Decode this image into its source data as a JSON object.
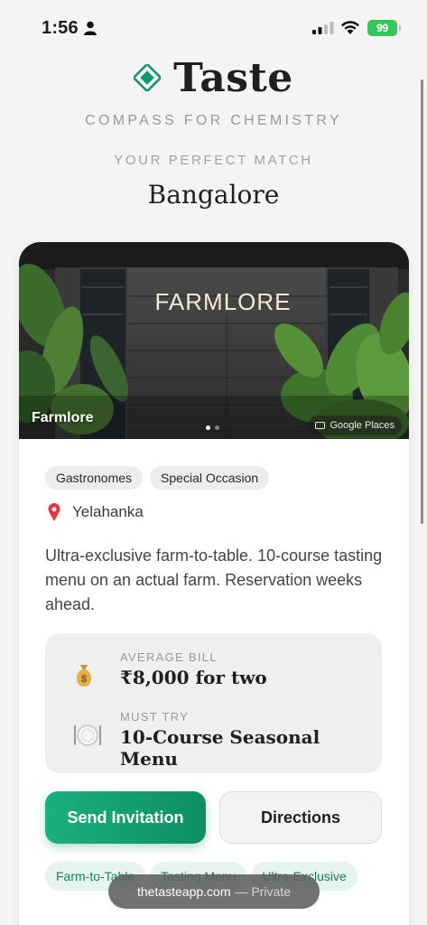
{
  "status_bar": {
    "time": "1:56",
    "battery": "99",
    "icons": [
      "person-icon",
      "signal-icon",
      "wifi-icon",
      "battery-icon"
    ]
  },
  "header": {
    "app_name": "Taste",
    "logo_icon": "diamond-logo-icon",
    "tagline": "COMPASS FOR CHEMISTRY",
    "subtitle": "YOUR PERFECT MATCH",
    "city": "Bangalore"
  },
  "card": {
    "photo": {
      "sign_text": "FARMLORE",
      "caption": "Farmlore",
      "source": "Google Places",
      "page_count": 2,
      "active_page": 1
    },
    "tags": [
      "Gastronomes",
      "Special Occasion"
    ],
    "location": "Yelahanka",
    "description": "Ultra-exclusive farm-to-table. 10-course tasting menu on an actual farm. Reservation weeks ahead.",
    "info": {
      "bill_label": "AVERAGE BILL",
      "bill_value": "₹8,000 for two",
      "bill_icon": "money-bag-icon",
      "must_try_label": "MUST TRY",
      "must_try_value": "10-Course Seasonal Menu",
      "must_try_icon": "plate-icon"
    },
    "buttons": {
      "primary": "Send Invitation",
      "secondary": "Directions"
    },
    "chips": [
      "Farm-to-Table",
      "Tasting Menu",
      "Ultra-Exclusive"
    ]
  },
  "browser": {
    "url": "thetasteapp.com",
    "mode": "— Private"
  },
  "colors": {
    "accent": "#12996b",
    "background": "#f4f4f2",
    "battery": "#35c759"
  }
}
